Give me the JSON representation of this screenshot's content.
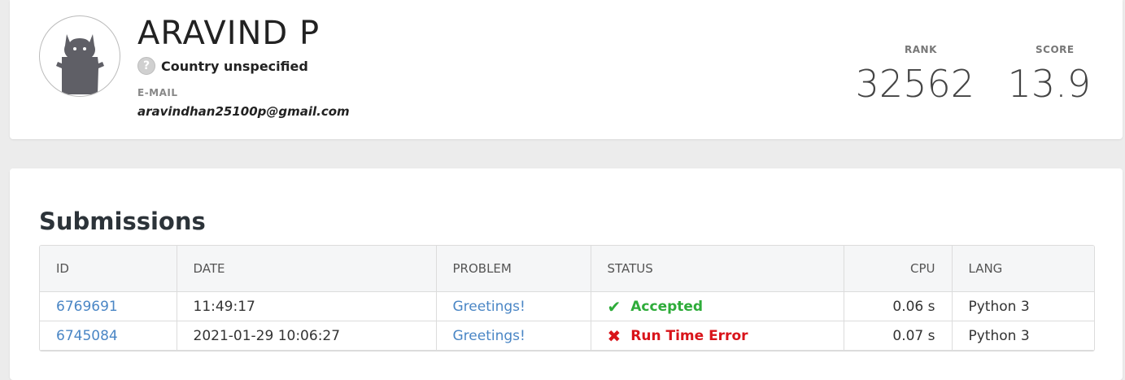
{
  "profile": {
    "name": "ARAVIND P",
    "country": "Country unspecified",
    "email_label": "E-MAIL",
    "email": "aravindhan25100p@gmail.com",
    "rank_label": "RANK",
    "rank": "32562",
    "score_label": "SCORE",
    "score": "13.9"
  },
  "submissions": {
    "title": "Submissions",
    "columns": [
      "ID",
      "DATE",
      "PROBLEM",
      "STATUS",
      "CPU",
      "LANG"
    ],
    "rows": [
      {
        "id": "6769691",
        "date": "11:49:17",
        "problem": "Greetings!",
        "status": "Accepted",
        "status_icon": "check-icon",
        "cpu": "0.06 s",
        "lang": "Python 3"
      },
      {
        "id": "6745084",
        "date": "2021-01-29 10:06:27",
        "problem": "Greetings!",
        "status": "Run Time Error",
        "status_icon": "cross-icon",
        "cpu": "0.07 s",
        "lang": "Python 3"
      }
    ]
  },
  "colors": {
    "accepted": "#2eac3a",
    "error": "#d9141a",
    "link": "#4a86c5"
  }
}
